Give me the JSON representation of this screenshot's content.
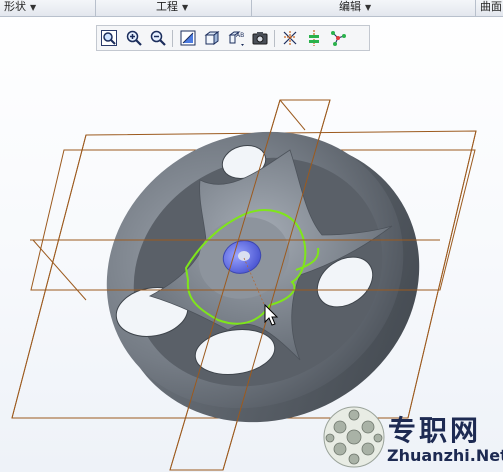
{
  "menubar": {
    "groups": [
      {
        "label": "形状",
        "arrow": "▼"
      },
      {
        "label": "工程",
        "arrow": "▼"
      },
      {
        "label": "编辑",
        "arrow": "▼"
      },
      {
        "label": "曲面"
      }
    ]
  },
  "toolbar": {
    "buttons": [
      {
        "icon": "zoom-fit-icon"
      },
      {
        "icon": "zoom-in-icon"
      },
      {
        "icon": "zoom-out-icon"
      },
      {
        "icon": "repaint-icon"
      },
      {
        "icon": "display-style-icon"
      },
      {
        "icon": "saved-views-icon"
      },
      {
        "icon": "view-manager-icon"
      },
      {
        "icon": "datum-planes-icon"
      },
      {
        "icon": "datum-axes-icon"
      },
      {
        "icon": "datum-points-icon"
      }
    ]
  },
  "watermark": {
    "cn": "专职网",
    "en": "Zhuanzhi.Net"
  },
  "colors": {
    "datum_plane": "#9c5a1e",
    "sketch_curve": "#7fe61a",
    "hub_face": "#6470e0",
    "part_steel": "#6c737c",
    "watermark_text": "#1d2a52"
  }
}
